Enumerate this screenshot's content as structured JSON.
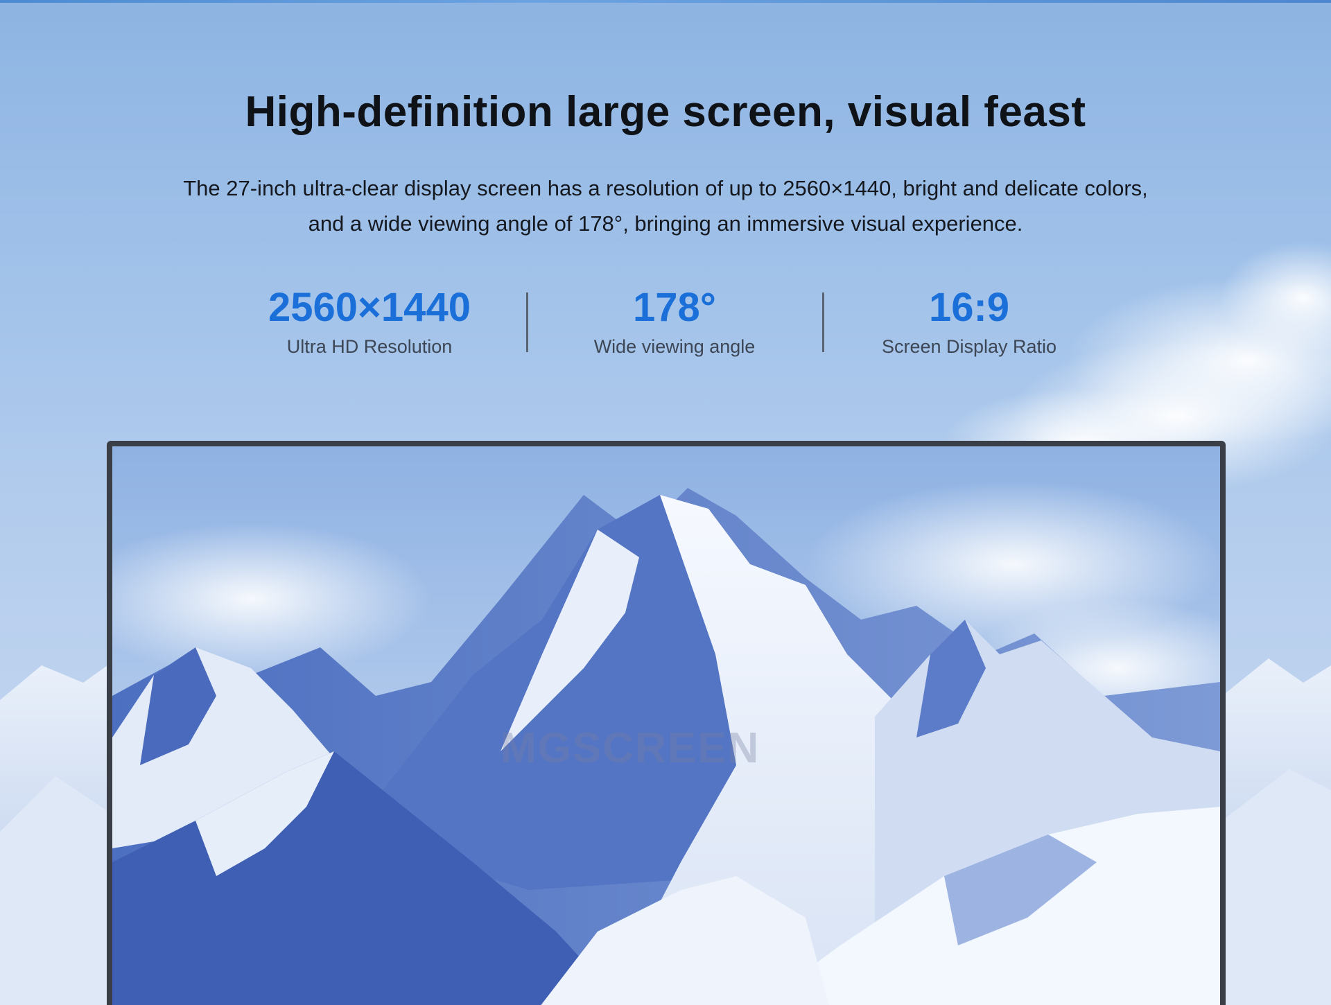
{
  "headline": "High-definition large screen, visual feast",
  "subtitle": {
    "line1": "The 27-inch ultra-clear display screen has a resolution of up to 2560×1440, bright and delicate colors,",
    "line2": "and a wide viewing angle of 178°, bringing an immersive visual experience."
  },
  "stats": [
    {
      "value": "2560×1440",
      "label": "Ultra HD Resolution"
    },
    {
      "value": "178°",
      "label": "Wide viewing angle"
    },
    {
      "value": "16:9",
      "label": "Screen Display Ratio"
    }
  ],
  "watermark": "MGSCREEN",
  "colors": {
    "accent": "#1a6fd8",
    "headline": "#0f1216",
    "bezel": "#3a3f47"
  }
}
